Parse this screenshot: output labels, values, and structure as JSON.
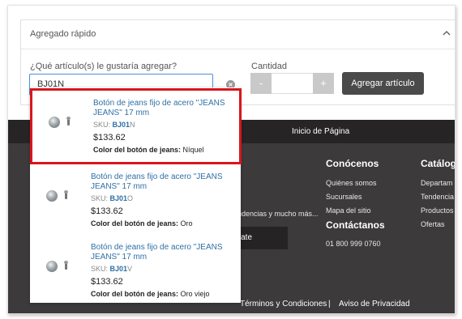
{
  "quick_add": {
    "title": "Agregado rápido",
    "question": "¿Qué artículo(s) le gustaría agregar?",
    "search_value": "BJ01N",
    "quantity_label": "Cantidad",
    "minus": "-",
    "plus": "+",
    "add_button": "Agregar artículo"
  },
  "footer": {
    "back_to_top": "Inicio de Página",
    "conocenos": {
      "title": "Conócenos",
      "links": [
        "Quiénes somos",
        "Sucursales",
        "Mapa del sitio"
      ]
    },
    "contactanos": {
      "title": "Contáctanos",
      "phone": "01 800 999 0760"
    },
    "catalogo": {
      "title": "Catálog",
      "links": [
        "Departam",
        "Tendencia",
        "Productos",
        "Ofertas"
      ]
    },
    "partial_text": "ndencias y mucho más...",
    "subscribe_button": "trate",
    "terms": "Términos y Condiciones",
    "separator": "|",
    "privacy": "Aviso de Privacidad"
  },
  "suggestions": [
    {
      "title": "Botón de jeans fijo de acero \"JEANS JEANS\" 17 mm",
      "sku_label": "SKU:",
      "sku_match": "BJ01",
      "sku_rest": "N",
      "price": "$133.62",
      "attr_label": "Color del botón de jeans:",
      "attr_value": "Níquel"
    },
    {
      "title": "Botón de jeans fijo de acero \"JEANS JEANS\" 17 mm",
      "sku_label": "SKU:",
      "sku_match": "BJ01",
      "sku_rest": "O",
      "price": "$133.62",
      "attr_label": "Color del botón de jeans:",
      "attr_value": "Oro"
    },
    {
      "title": "Botón de jeans fijo de acero \"JEANS JEANS\" 17 mm",
      "sku_label": "SKU:",
      "sku_match": "BJ01",
      "sku_rest": "V",
      "price": "$133.62",
      "attr_label": "Color del botón de jeans:",
      "attr_value": "Oro viejo"
    }
  ]
}
